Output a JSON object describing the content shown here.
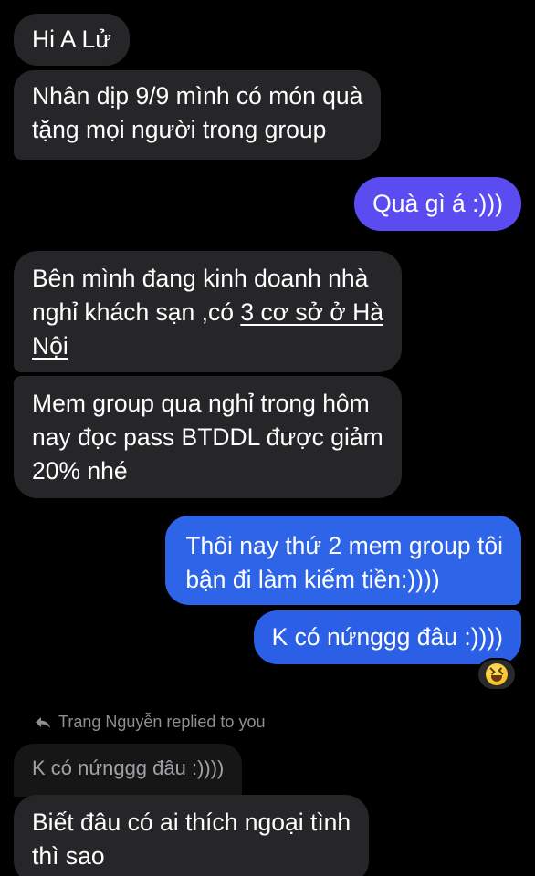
{
  "messages": {
    "m1": "Hi A Lử",
    "m2_line1": "Nhân dịp 9/9 mình có món quà",
    "m2_line2": "tặng mọi người trong group",
    "m3": "Quà gì á :)))",
    "m4_line1": "Bên mình đang kinh doanh nhà",
    "m4_line2_plain": "nghỉ khách sạn ,có ",
    "m4_line2_link": "3 cơ sở ở Hà",
    "m4_line3_link": "Nội",
    "m5_line1": "Mem group qua nghỉ trong hôm",
    "m5_line2": "nay đọc pass BTDDL được giảm",
    "m5_line3": "20% nhé",
    "m6_line1": "Thôi nay thứ 2 mem group tôi",
    "m6_line2": "bận đi làm kiếm tiền:))))",
    "m7": "K có nứnggg đâu :))))",
    "m8_line1": "Biết đâu có ai thích ngoại tình",
    "m8_line2": "thì sao"
  },
  "reaction": {
    "emoji": "grinning-squinting-face-icon"
  },
  "reply": {
    "label": "Trang Nguyễn replied to you",
    "quoted_text": "K có nứnggg đâu :))))"
  },
  "colors": {
    "incoming_bubble": "#262628",
    "outgoing_purple": "#5b4cf2",
    "outgoing_blue": "#2e64e8",
    "background": "#000000"
  }
}
